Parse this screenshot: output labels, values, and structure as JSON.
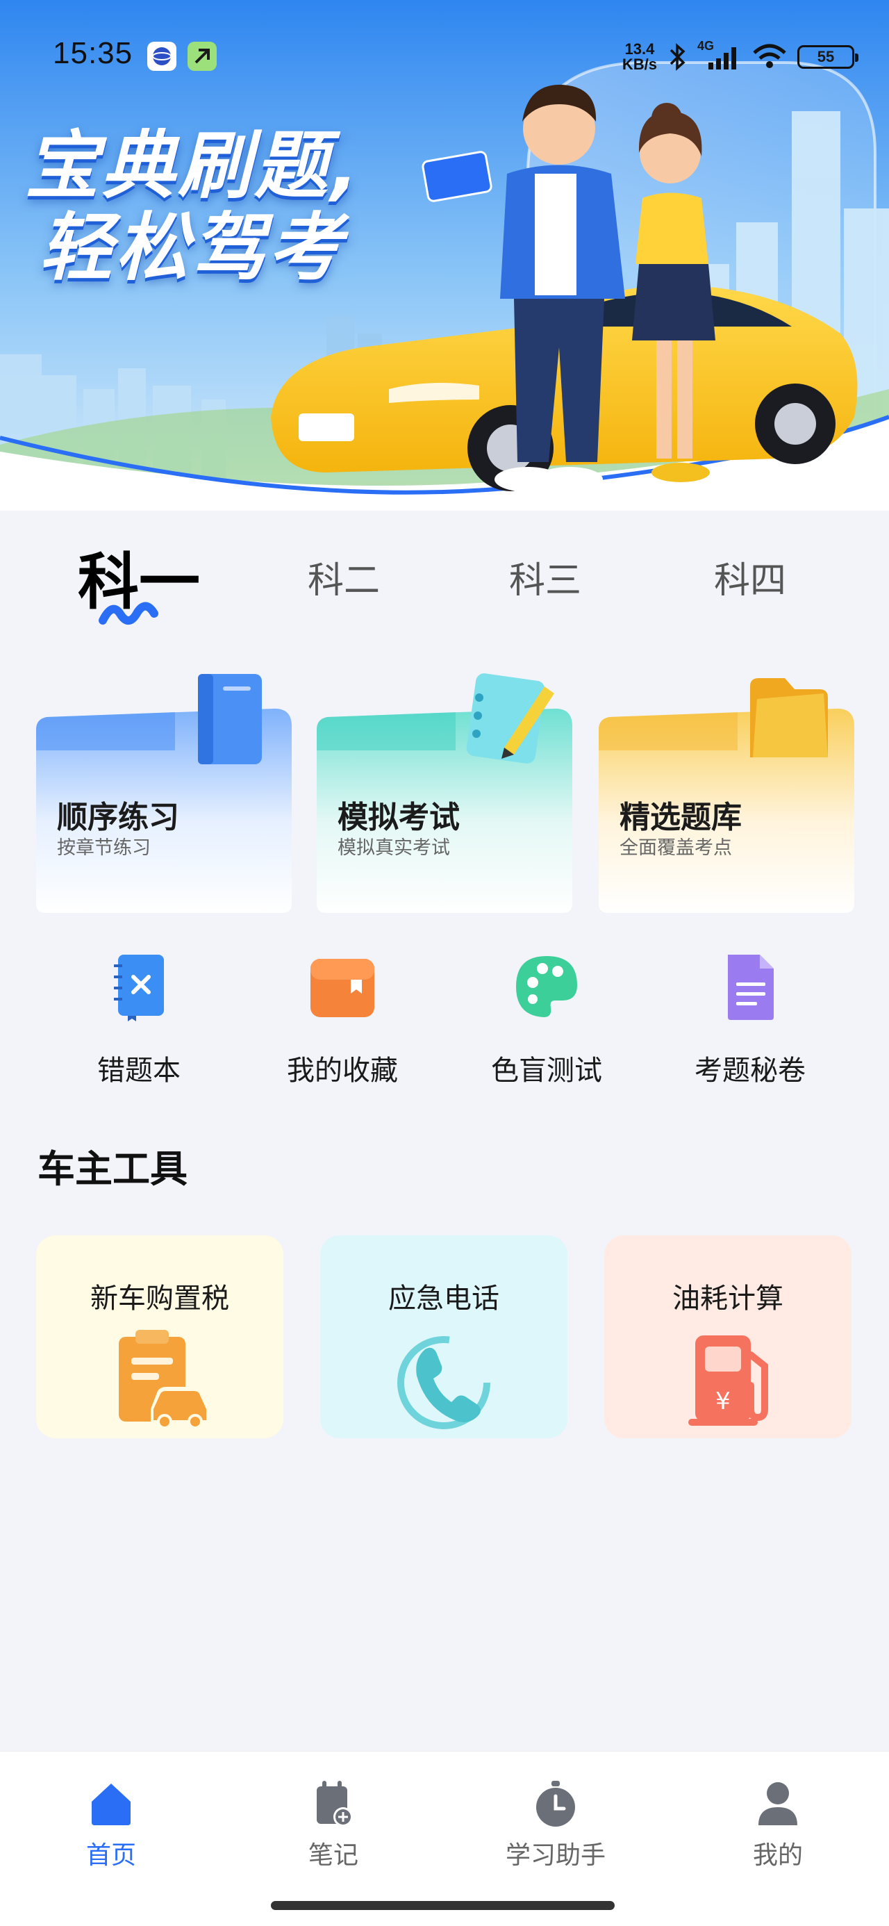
{
  "status_bar": {
    "time": "15:35",
    "net_speed_value": "13.4",
    "net_speed_unit": "KB/s",
    "network_type": "4G",
    "battery": "55"
  },
  "hero": {
    "title_line1": "宝典刷题,",
    "title_line2": "轻松驾考"
  },
  "subject_tabs": [
    {
      "label": "科一",
      "active": true
    },
    {
      "label": "科二",
      "active": false
    },
    {
      "label": "科三",
      "active": false
    },
    {
      "label": "科四",
      "active": false
    }
  ],
  "practice_cards": [
    {
      "title": "顺序练习",
      "subtitle": "按章节练习",
      "icon": "book-icon",
      "color": "#4a90f5"
    },
    {
      "title": "模拟考试",
      "subtitle": "模拟真实考试",
      "icon": "notebook-pencil-icon",
      "color": "#3ccfc0"
    },
    {
      "title": "精选题库",
      "subtitle": "全面覆盖考点",
      "icon": "folder-icon",
      "color": "#f5b82e"
    }
  ],
  "quick_entries": [
    {
      "label": "错题本",
      "icon": "wrong-notebook-icon",
      "color": "#3b8ef3"
    },
    {
      "label": "我的收藏",
      "icon": "favorites-box-icon",
      "color": "#f5843a"
    },
    {
      "label": "色盲测试",
      "icon": "palette-icon",
      "color": "#3ccf9a"
    },
    {
      "label": "考题秘卷",
      "icon": "document-icon",
      "color": "#9b7cf0"
    }
  ],
  "tools_section": {
    "title": "车主工具",
    "items": [
      {
        "title": "新车购置税",
        "icon": "car-tax-icon",
        "bg": "#fffbe4",
        "color": "#f5a23b"
      },
      {
        "title": "应急电话",
        "icon": "phone-icon",
        "bg": "#ddf7fa",
        "color": "#4cc3cc"
      },
      {
        "title": "油耗计算",
        "icon": "fuel-pump-icon",
        "bg": "#ffebe3",
        "color": "#f5735e"
      }
    ]
  },
  "bottom_nav": [
    {
      "label": "首页",
      "icon": "home-icon",
      "active": true
    },
    {
      "label": "笔记",
      "icon": "notes-icon",
      "active": false
    },
    {
      "label": "学习助手",
      "icon": "timer-icon",
      "active": false
    },
    {
      "label": "我的",
      "icon": "profile-icon",
      "active": false
    }
  ],
  "colors": {
    "accent": "#2a6ef6",
    "page_bg": "#f3f4f9"
  }
}
